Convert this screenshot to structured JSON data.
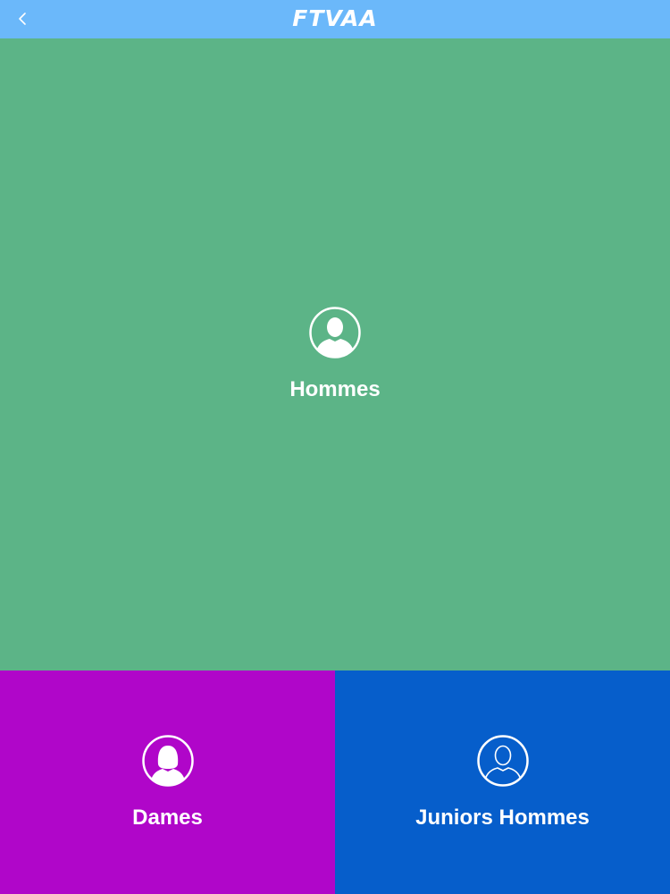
{
  "header": {
    "title": "FTVAA",
    "back_icon": "chevron-left-icon",
    "background": "#6bb8fa"
  },
  "categories": [
    {
      "label": "Hommes",
      "icon": "man-avatar-icon",
      "color": "#5cb487"
    },
    {
      "label": "Dames",
      "icon": "woman-avatar-icon",
      "color": "#b006c9"
    },
    {
      "label": "Juniors Hommes",
      "icon": "man-outline-avatar-icon",
      "color": "#065ecb"
    }
  ]
}
